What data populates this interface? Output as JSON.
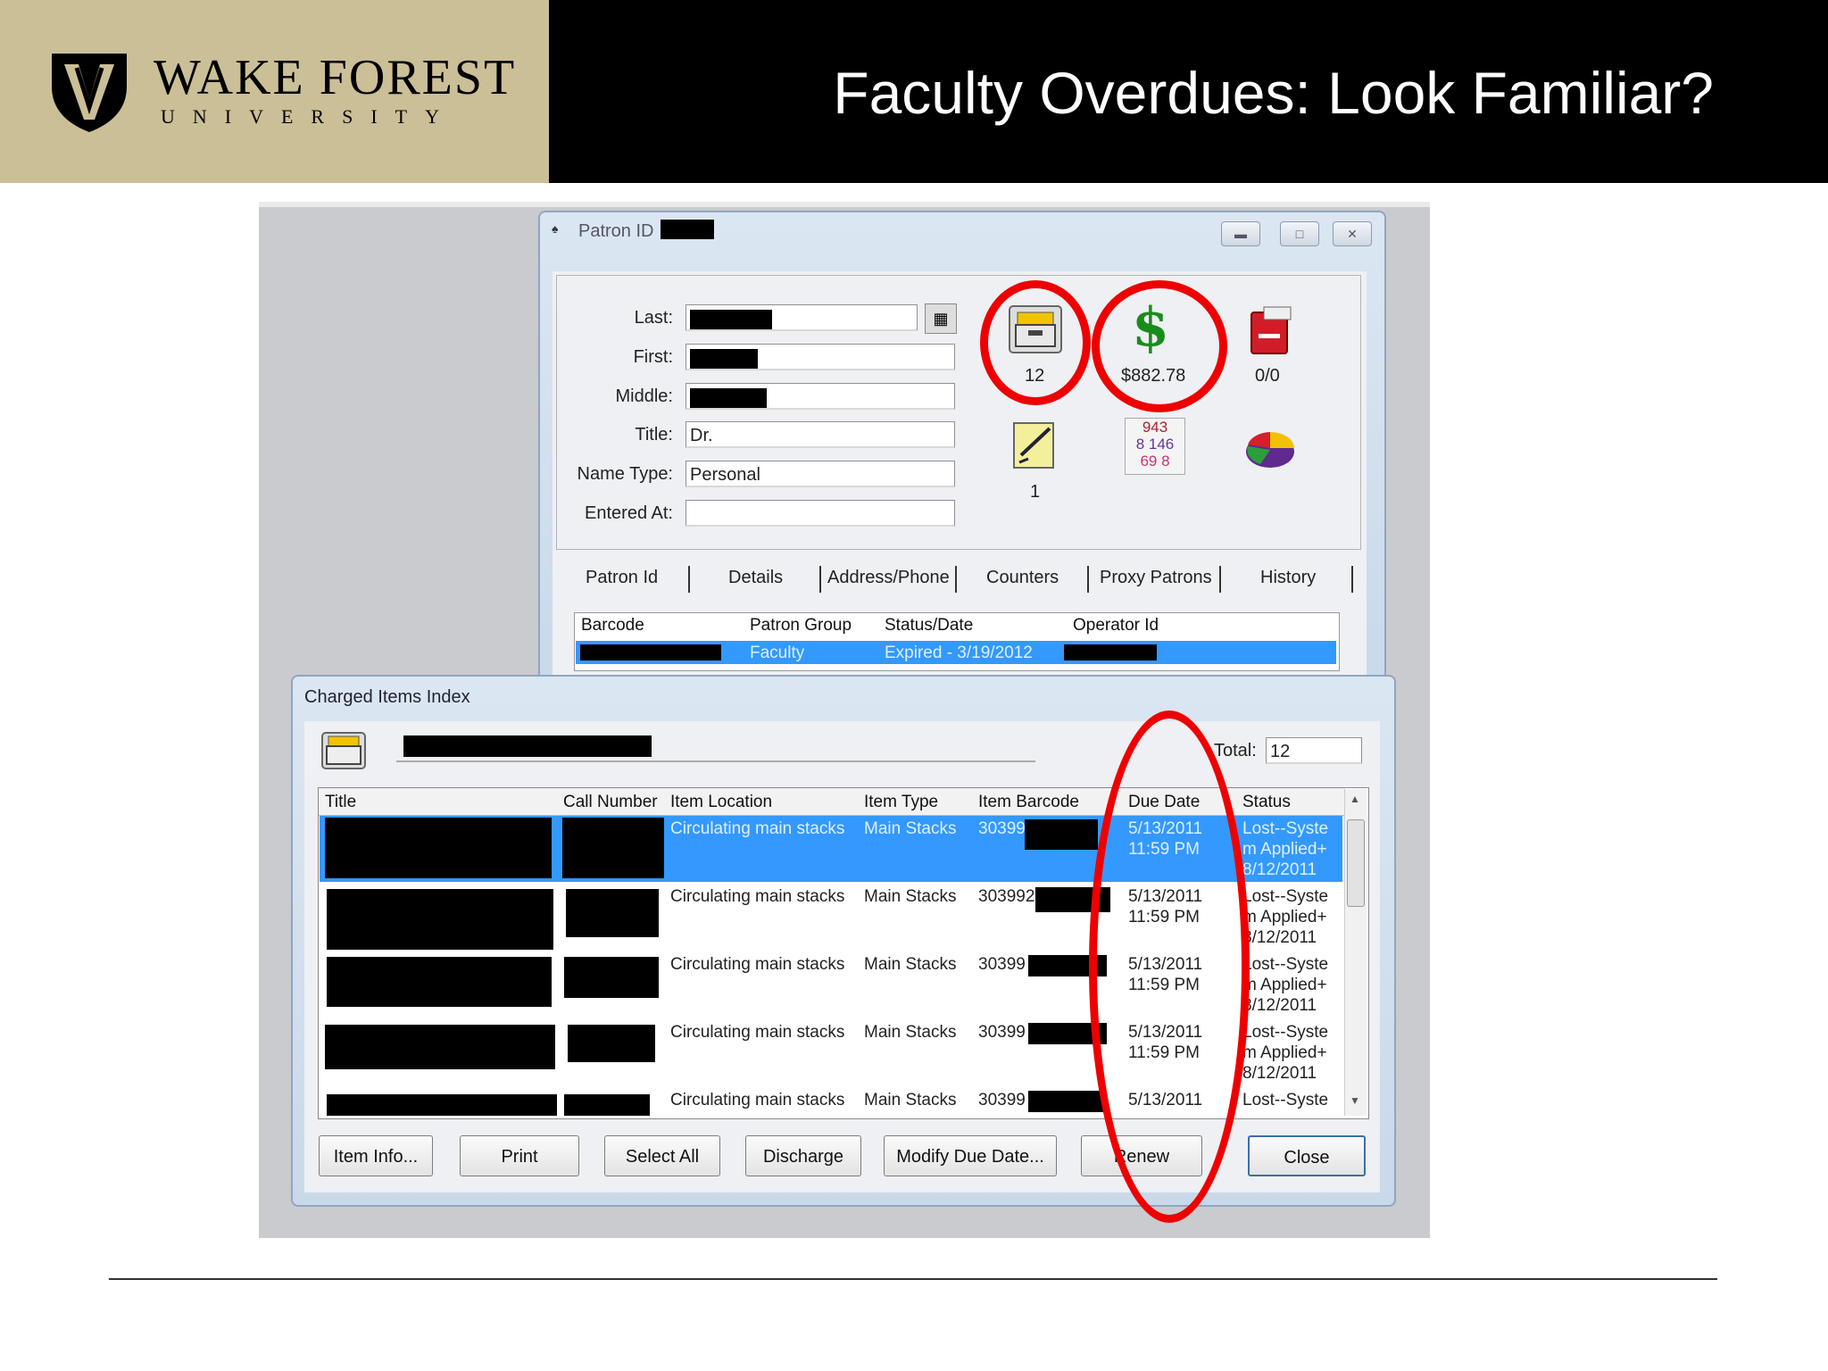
{
  "slide": {
    "title": "Faculty Overdues: Look Familiar?",
    "logo": {
      "name": "WAKE FOREST",
      "sub": "UNIVERSITY"
    }
  },
  "patron_window": {
    "title": "Patron ID",
    "fields": {
      "last_label": "Last:",
      "first_label": "First:",
      "middle_label": "Middle:",
      "title_label": "Title:",
      "title_value": "Dr.",
      "name_type_label": "Name Type:",
      "name_type_value": "Personal",
      "entered_at_label": "Entered At:"
    },
    "stats": {
      "charged_count": "12",
      "fines_amount": "$882.78",
      "holds": "0/0",
      "notes_count": "1",
      "counters_icon_digits": [
        "943",
        "8 146",
        "69 8"
      ]
    },
    "tabs": [
      "Patron Id",
      "Details",
      "Address/Phone",
      "Counters",
      "Proxy Patrons",
      "History"
    ],
    "table": {
      "headers": [
        "Barcode",
        "Patron Group",
        "Status/Date",
        "Operator Id"
      ],
      "row": {
        "patron_group": "Faculty",
        "status_date": "Expired - 3/19/2012"
      }
    }
  },
  "charged_window": {
    "title": "Charged Items Index",
    "total_label": "Total:",
    "total_value": "12",
    "headers": [
      "Title",
      "Call Number",
      "Item Location",
      "Item Type",
      "Item Barcode",
      "Due Date",
      "Status"
    ],
    "rows": [
      {
        "location": "Circulating main stacks",
        "type": "Main Stacks",
        "barcode": "30399",
        "due": [
          "5/13/2011",
          "11:59 PM"
        ],
        "status": [
          "Lost--Syste",
          "m Applied+",
          "8/12/2011"
        ]
      },
      {
        "location": "Circulating main stacks",
        "type": "Main Stacks",
        "barcode": "303992",
        "due": [
          "5/13/2011",
          "11:59 PM"
        ],
        "status": [
          "Lost--Syste",
          "m Applied+",
          "8/12/2011"
        ]
      },
      {
        "location": "Circulating main stacks",
        "type": "Main Stacks",
        "barcode": "30399",
        "due": [
          "5/13/2011",
          "11:59 PM"
        ],
        "status": [
          "Lost--Syste",
          "m Applied+",
          "8/12/2011"
        ]
      },
      {
        "location": "Circulating main stacks",
        "type": "Main Stacks",
        "barcode": "30399",
        "due": [
          "5/13/2011",
          "11:59 PM"
        ],
        "status": [
          "Lost--Syste",
          "m Applied+",
          "8/12/2011"
        ]
      },
      {
        "location": "Circulating main stacks",
        "type": "Main Stacks",
        "barcode": "30399",
        "due": [
          "5/13/2011"
        ],
        "status": [
          "Lost--Syste"
        ]
      }
    ],
    "buttons": [
      "Item Info...",
      "Print",
      "Select All",
      "Discharge",
      "Modify Due Date...",
      "Renew",
      "Close"
    ]
  },
  "colors": {
    "highlight_ring": "#ee0000",
    "selection": "#3399ff",
    "logo_band": "#cbbf97"
  }
}
